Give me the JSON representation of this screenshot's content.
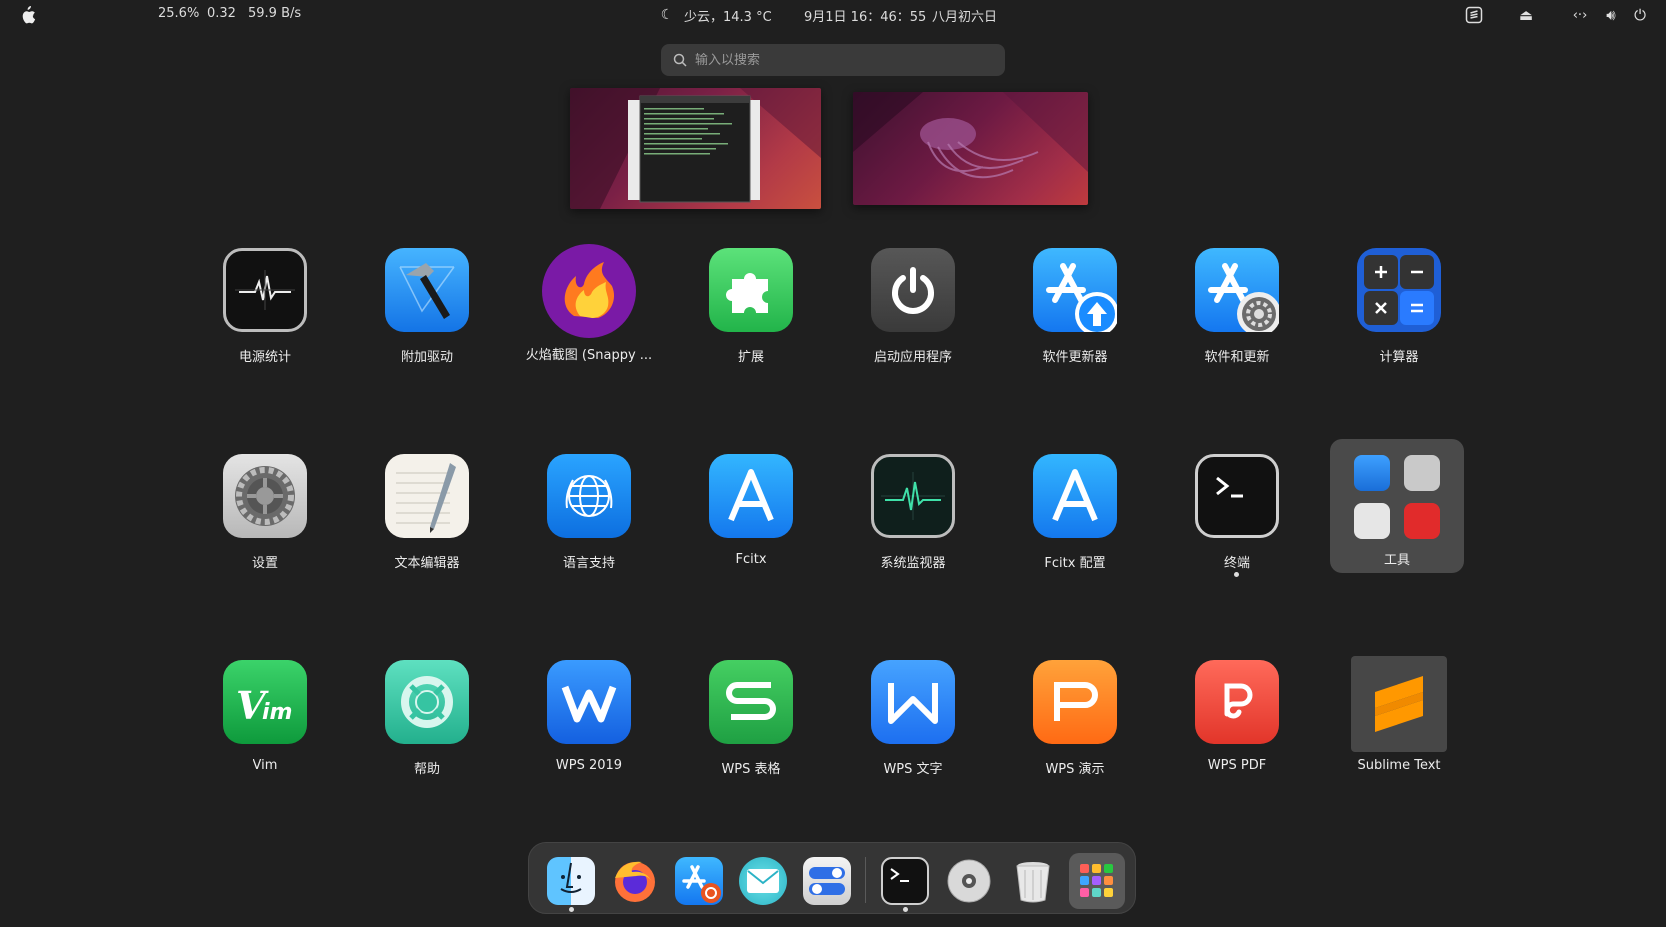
{
  "topbar": {
    "cpu": "25.6%",
    "load": "0.32",
    "net": "59.9 B/s",
    "weather": "少云，14.3 °C",
    "datetime": "9月1日  16：46：55",
    "lunar": "八月初六日"
  },
  "search": {
    "placeholder": "输入以搜索"
  },
  "apps": [
    {
      "label": "电源统计",
      "icon": "power-stats-icon"
    },
    {
      "label": "附加驱动",
      "icon": "hammer-icon"
    },
    {
      "label": "火焰截图 (Snappy ...",
      "icon": "flameshot-icon"
    },
    {
      "label": "扩展",
      "icon": "puzzle-icon"
    },
    {
      "label": "启动应用程序",
      "icon": "power-icon"
    },
    {
      "label": "软件更新器",
      "icon": "app-store-update-icon"
    },
    {
      "label": "软件和更新",
      "icon": "app-store-gear-icon"
    },
    {
      "label": "计算器",
      "icon": "calculator-icon"
    },
    {
      "label": "设置",
      "icon": "gear-icon"
    },
    {
      "label": "文本编辑器",
      "icon": "text-editor-icon"
    },
    {
      "label": "语言支持",
      "icon": "globe-icon"
    },
    {
      "label": "Fcitx",
      "icon": "fcitx-icon"
    },
    {
      "label": "系统监视器",
      "icon": "system-monitor-icon"
    },
    {
      "label": "Fcitx 配置",
      "icon": "fcitx-config-icon"
    },
    {
      "label": "终端",
      "icon": "terminal-icon"
    },
    {
      "label": "工具",
      "icon": "folder-icon"
    },
    {
      "label": "Vim",
      "icon": "vim-icon"
    },
    {
      "label": "帮助",
      "icon": "help-icon"
    },
    {
      "label": "WPS 2019",
      "icon": "wps-icon"
    },
    {
      "label": "WPS 表格",
      "icon": "wps-sheet-icon"
    },
    {
      "label": "WPS 文字",
      "icon": "wps-writer-icon"
    },
    {
      "label": "WPS 演示",
      "icon": "wps-presentation-icon"
    },
    {
      "label": "WPS PDF",
      "icon": "wps-pdf-icon"
    },
    {
      "label": "Sublime Text",
      "icon": "sublime-text-icon"
    }
  ],
  "dock": [
    "finder-icon",
    "firefox-icon",
    "app-store-icon",
    "mail-icon",
    "toggle-settings-icon",
    "terminal-icon",
    "disc-icon",
    "trash-icon",
    "launchpad-icon"
  ],
  "colors": {
    "background": "#1f1f1f",
    "dock": "#353535",
    "search": "#3a3a3a"
  }
}
